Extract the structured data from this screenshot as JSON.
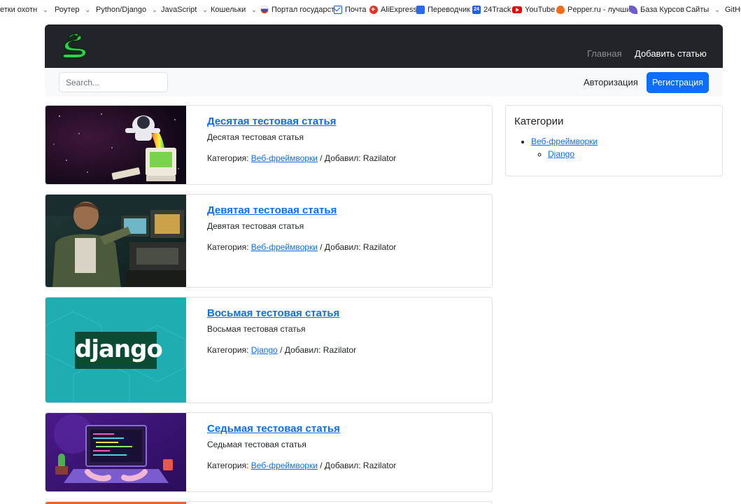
{
  "bookmarks": [
    {
      "label": "етки охотн",
      "icon": "none",
      "dropdown": true
    },
    {
      "label": "Роутер",
      "icon": "none",
      "dropdown": true
    },
    {
      "label": "Python/Django",
      "icon": "none",
      "dropdown": true
    },
    {
      "label": "JavaScript",
      "icon": "none",
      "dropdown": true
    },
    {
      "label": "Кошельки",
      "icon": "none",
      "dropdown": true
    },
    {
      "label": "Портал государст",
      "icon": "russia-flag-icon",
      "dropdown": false
    },
    {
      "label": "Почта",
      "icon": "mail-icon",
      "dropdown": false
    },
    {
      "label": "AliExpress",
      "icon": "aliexpress-icon",
      "dropdown": false
    },
    {
      "label": "Переводчик",
      "icon": "translate-icon",
      "dropdown": false
    },
    {
      "label": "24Track",
      "icon": "24track-icon",
      "dropdown": false
    },
    {
      "label": "YouTube",
      "icon": "youtube-icon",
      "dropdown": false
    },
    {
      "label": "Pepper.ru - лучши",
      "icon": "pepper-icon",
      "dropdown": false
    },
    {
      "label": "База Курсов",
      "icon": "leaf-icon",
      "dropdown": false
    },
    {
      "label": "Сайты",
      "icon": "none",
      "dropdown": true
    },
    {
      "label": "GitHu",
      "icon": "none",
      "dropdown": false
    }
  ],
  "navbar": {
    "home_label": "Главная",
    "add_article_label": "Добавить статью",
    "logo_icon": "snake-logo-icon"
  },
  "subbar": {
    "search_placeholder": "Search...",
    "login_label": "Авторизация",
    "register_label": "Регистрация"
  },
  "articles": [
    {
      "title": "Десятая тестовая статья",
      "description": "Десятая тестовая статья",
      "category_prefix": "Категория:",
      "category": "Веб-фреймворки",
      "author_prefix": "/ Добавил:",
      "author": "Razilator",
      "image": "astronaut-retro-computer-illustration"
    },
    {
      "title": "Девятая тестовая статья",
      "description": "Девятая тестовая статья",
      "category_prefix": "Категория:",
      "category": "Веб-фреймворки",
      "author_prefix": "/ Добавил:",
      "author": "Razilator",
      "image": "man-with-retro-computers-photo"
    },
    {
      "title": "Восьмая тестовая статья",
      "description": "Восьмая тестовая статья",
      "category_prefix": "Категория:",
      "category": "Django",
      "author_prefix": "/ Добавил:",
      "author": "Razilator",
      "image": "django-logo",
      "image_text": "django"
    },
    {
      "title": "Седьмая тестовая статья",
      "description": "Седьмая тестовая статья",
      "category_prefix": "Категория:",
      "category": "Веб-фреймворки",
      "author_prefix": "/ Добавил:",
      "author": "Razilator",
      "image": "laptop-coding-illustration"
    }
  ],
  "sidebar": {
    "title": "Категории",
    "categories": [
      {
        "label": "Веб-фреймворки",
        "children": [
          {
            "label": "Django"
          }
        ]
      }
    ]
  },
  "colors": {
    "navbar_bg": "#212529",
    "subbar_bg": "#f8f9fa",
    "primary": "#0d6efd",
    "logo_green": "#2bd34c",
    "django_teal": "#1eaeb2",
    "django_green": "#0c4b33"
  }
}
